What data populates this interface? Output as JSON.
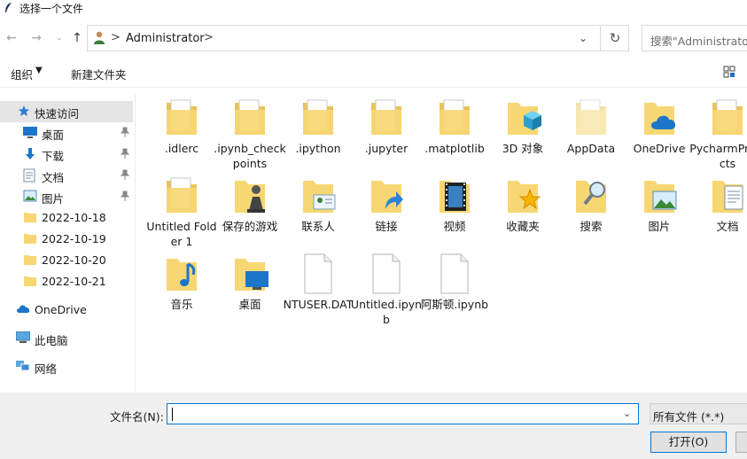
{
  "window": {
    "title": "选择一个文件"
  },
  "address": {
    "crumb": "Administrator",
    "separator": ">"
  },
  "search": {
    "placeholder": "搜索\"Administrator\""
  },
  "toolbar": {
    "organize": "组织",
    "new_folder": "新建文件夹"
  },
  "sidebar": {
    "items": [
      {
        "label": "快速访问",
        "icon": "star-icon",
        "pinned": false
      },
      {
        "label": "桌面",
        "icon": "desktop-icon",
        "pinned": true
      },
      {
        "label": "下载",
        "icon": "download-icon",
        "pinned": true
      },
      {
        "label": "文档",
        "icon": "document-icon",
        "pinned": true
      },
      {
        "label": "图片",
        "icon": "pictures-icon",
        "pinned": true
      },
      {
        "label": "2022-10-18",
        "icon": "folder-icon",
        "pinned": false
      },
      {
        "label": "2022-10-19",
        "icon": "folder-icon",
        "pinned": false
      },
      {
        "label": "2022-10-20",
        "icon": "folder-icon",
        "pinned": false
      },
      {
        "label": "2022-10-21",
        "icon": "folder-icon",
        "pinned": false
      },
      {
        "label": "OneDrive",
        "icon": "cloud-icon",
        "pinned": false
      },
      {
        "label": "此电脑",
        "icon": "computer-icon",
        "pinned": false
      },
      {
        "label": "网络",
        "icon": "network-icon",
        "pinned": false
      }
    ]
  },
  "files": [
    {
      "name": ".idlerc",
      "kind": "folder-doc"
    },
    {
      "name": ".ipynb_checkpoints",
      "kind": "folder-doc"
    },
    {
      "name": ".ipython",
      "kind": "folder-doc"
    },
    {
      "name": ".jupyter",
      "kind": "folder-doc"
    },
    {
      "name": ".matplotlib",
      "kind": "folder-doc"
    },
    {
      "name": "3D 对象",
      "kind": "folder-3d"
    },
    {
      "name": "AppData",
      "kind": "folder-light"
    },
    {
      "name": "OneDrive",
      "kind": "folder-cloud"
    },
    {
      "name": "PycharmProjects",
      "kind": "folder-doc"
    },
    {
      "name": "Untitled Folder 1",
      "kind": "folder-doc"
    },
    {
      "name": "保存的游戏",
      "kind": "folder-game"
    },
    {
      "name": "联系人",
      "kind": "folder-contact"
    },
    {
      "name": "链接",
      "kind": "folder-link"
    },
    {
      "name": "视频",
      "kind": "folder-video"
    },
    {
      "name": "收藏夹",
      "kind": "folder-star"
    },
    {
      "name": "搜索",
      "kind": "folder-search"
    },
    {
      "name": "图片",
      "kind": "folder-picture"
    },
    {
      "name": "文档",
      "kind": "folder-docs"
    },
    {
      "name": "音乐",
      "kind": "folder-music"
    },
    {
      "name": "桌面",
      "kind": "folder-desktop"
    },
    {
      "name": "NTUSER.DAT",
      "kind": "file"
    },
    {
      "name": "Untitled.ipynb",
      "kind": "file"
    },
    {
      "name": "阿斯顿.ipynb",
      "kind": "file"
    }
  ],
  "bottom": {
    "filename_label": "文件名(N):",
    "filename_value": "",
    "filetype": "所有文件 (*.*)",
    "open_label": "打开(O)"
  },
  "colors": {
    "accent": "#0078d7",
    "folder": "#f7d774",
    "selection": "#e5e5e5"
  }
}
